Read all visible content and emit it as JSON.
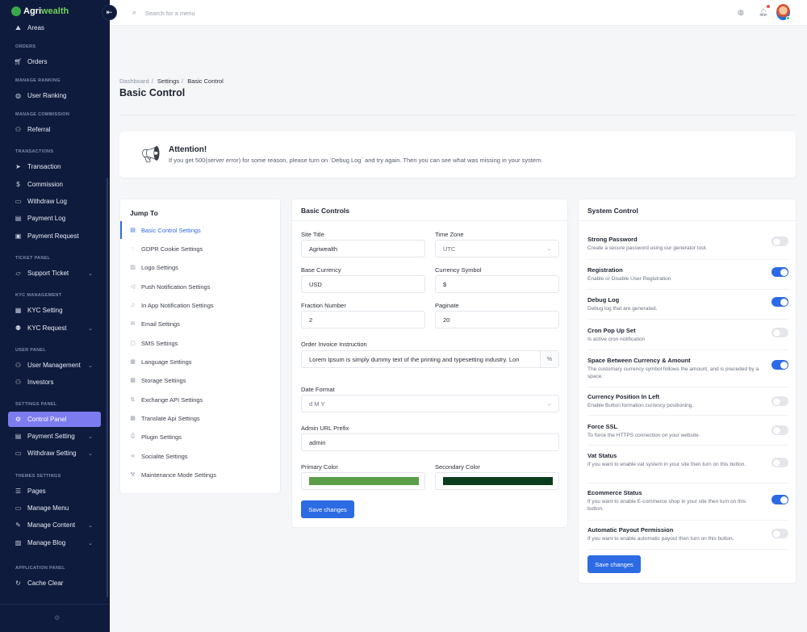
{
  "brand": {
    "name_a": "Agri",
    "name_b": "wealth"
  },
  "sidebar": {
    "sections": [
      "ORDERS",
      "MANAGE RANKING",
      "MANAGE COMMISSION",
      "TRANSACTIONS",
      "TICKET PANEL",
      "KYC MANAGEMENT",
      "USER PANEL",
      "SETTINGS PANEL",
      "THEMES SETTINGS",
      "APPLICATION PANEL"
    ],
    "items": [
      {
        "label": "Areas",
        "icon": "map-icon"
      },
      {
        "label": "Orders",
        "icon": "cart-icon"
      },
      {
        "label": "User Ranking",
        "icon": "globe-icon"
      },
      {
        "label": "Referral",
        "icon": "users-icon"
      },
      {
        "label": "Transaction",
        "icon": "send-icon"
      },
      {
        "label": "Commission",
        "icon": "dollar-icon"
      },
      {
        "label": "Withdraw Log",
        "icon": "wallet-icon"
      },
      {
        "label": "Payment Log",
        "icon": "card-icon"
      },
      {
        "label": "Payment Request",
        "icon": "card-icon"
      },
      {
        "label": "Support Ticket",
        "icon": "ticket-icon"
      },
      {
        "label": "KYC Setting",
        "icon": "id-icon"
      },
      {
        "label": "KYC Request",
        "icon": "user-icon"
      },
      {
        "label": "User Management",
        "icon": "users-icon"
      },
      {
        "label": "Investors",
        "icon": "users-icon"
      },
      {
        "label": "Control Panel",
        "icon": "gear-icon"
      },
      {
        "label": "Payment Setting",
        "icon": "card-icon"
      },
      {
        "label": "Withdraw Setting",
        "icon": "wallet-icon"
      },
      {
        "label": "Pages",
        "icon": "list-icon"
      },
      {
        "label": "Manage Menu",
        "icon": "folder-icon"
      },
      {
        "label": "Manage Content",
        "icon": "pen-icon"
      },
      {
        "label": "Manage Blog",
        "icon": "image-icon"
      },
      {
        "label": "Cache Clear",
        "icon": "refresh-icon"
      }
    ]
  },
  "topbar": {
    "search_placeholder": "Search for a menu"
  },
  "breadcrumb": {
    "a": "Dashboard",
    "sep": "/",
    "b": "Settings",
    "c": "Basic Control"
  },
  "page_title": "Basic Control",
  "alert": {
    "title": "Attention!",
    "message": "If you get 500(server error) for some reason, please turn on `Debug Log` and try again. Then you can see what was missing in your system."
  },
  "jump": {
    "title": "Jump To",
    "items": [
      "Basic Control Settings",
      "GDPR Cookie Settings",
      "Logo Settings",
      "Push Notification Settings",
      "In App Notification Settings",
      "Email Settings",
      "SMS Settings",
      "Language Settings",
      "Storage Settings",
      "Exchange API Settings",
      "Translate Api Settings",
      "Plugin Settings",
      "Socialite Settings",
      "Maintenance Mode Settings"
    ]
  },
  "basic": {
    "title": "Basic Controls",
    "site_title_label": "Site Title",
    "site_title": "Agriwealth",
    "timezone_label": "Time Zone",
    "timezone": "UTC",
    "base_currency_label": "Base Currency",
    "base_currency": "USD",
    "currency_symbol_label": "Currency Symbol",
    "currency_symbol": "$",
    "fraction_label": "Fraction Number",
    "fraction": "2",
    "paginate_label": "Paginate",
    "paginate": "20",
    "invoice_label": "Order Invoice Instruction",
    "invoice": "Lorem Ipsum is simply dummy text of the printing and typesetting industry. Lorem Ipsum",
    "invoice_suffix": "%",
    "date_format_label": "Date Format",
    "date_format": "d M Y",
    "admin_prefix_label": "Admin URL Prefix",
    "admin_prefix": "admin",
    "primary_color_label": "Primary Color",
    "primary_color": "#5c9e4a",
    "secondary_color_label": "Secondary Color",
    "secondary_color": "#0a3d1c",
    "save": "Save changes"
  },
  "system": {
    "title": "System Control",
    "rows": [
      {
        "title": "Strong Password",
        "desc": "Create a secure password using our generator tool.",
        "on": false
      },
      {
        "title": "Registration",
        "desc": "Enable or Disable User Registration",
        "on": true
      },
      {
        "title": "Debug Log",
        "desc": "Debug log that are generated.",
        "on": true
      },
      {
        "title": "Cron Pop Up Set",
        "desc": "Is active cron notification",
        "on": false
      },
      {
        "title": "Space Between Currency & Amount",
        "desc": "The customary currency symbol follows the amount, and is preceded by a space.",
        "on": true
      },
      {
        "title": "Currency Position In Left",
        "desc": "Enable Button formation currency positioning.",
        "on": false
      },
      {
        "title": "Force SSL",
        "desc": "To force the HTTPS connection on your website.",
        "on": false
      },
      {
        "title": "Vat Status",
        "desc": "If you want to enable vat system in your site then turn on this button.",
        "on": false
      },
      {
        "title": "Ecommerce Status",
        "desc": "If you want to enable E-commerce shop in your site then turn on this button.",
        "on": true
      },
      {
        "title": "Automatic Payout Permission",
        "desc": "If you want to enable automatic payout then turn on this button.",
        "on": false
      }
    ],
    "save": "Save changes"
  },
  "colors": {
    "accent": "#2d6be4",
    "sidebar_bg": "#0f1b3d",
    "active_item": "#7c7cf0"
  }
}
